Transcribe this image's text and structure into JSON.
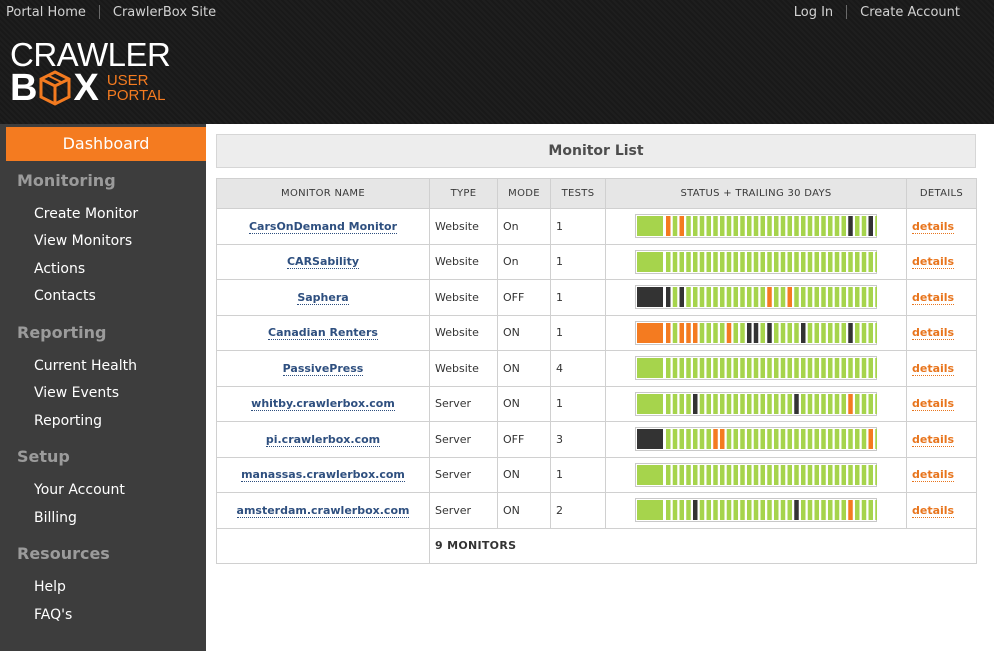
{
  "topnav": {
    "left": [
      "Portal Home",
      "CrawlerBox Site"
    ],
    "right": [
      "Log In",
      "Create Account"
    ]
  },
  "logo": {
    "line1": "CRAWLER",
    "b": "B",
    "x": "X",
    "sub1": "USER",
    "sub2": "PORTAL",
    "accent": "#f47b20"
  },
  "sidebar": {
    "dashboard": "Dashboard",
    "sections": [
      {
        "title": "Monitoring",
        "items": [
          "Create Monitor",
          "View Monitors",
          "Actions",
          "Contacts"
        ]
      },
      {
        "title": "Reporting",
        "items": [
          "Current Health",
          "View Events",
          "Reporting"
        ]
      },
      {
        "title": "Setup",
        "items": [
          "Your Account",
          "Billing"
        ]
      },
      {
        "title": "Resources",
        "items": [
          "Help",
          "FAQ's"
        ]
      }
    ]
  },
  "panel": {
    "title": "Monitor List"
  },
  "table": {
    "headers": [
      "MONITOR NAME",
      "TYPE",
      "MODE",
      "TESTS",
      "STATUS + TRAILING 30 DAYS",
      "DETAILS"
    ],
    "status_colors": {
      "g": "#a6d44c",
      "o": "#f47b20",
      "d": "#333333"
    },
    "rows": [
      {
        "name": "CarsOnDemand Monitor",
        "type": "Website",
        "mode": "On",
        "tests": "1",
        "current": "g",
        "days": "ogoggggggggggggggggggggggggdggdg",
        "details": "details"
      },
      {
        "name": "CARSability",
        "type": "Website",
        "mode": "On",
        "tests": "1",
        "current": "g",
        "days": "gggggggggggggggggggggggggggggggg",
        "details": "details"
      },
      {
        "name": "Saphera",
        "type": "Website",
        "mode": "OFF",
        "tests": "1",
        "current": "d",
        "days": "dgdggggggggggggoggoggggggggggggg",
        "details": "details"
      },
      {
        "name": "Canadian Renters",
        "type": "Website",
        "mode": "ON",
        "tests": "1",
        "current": "o",
        "days": "ogoooggggoggddgdggggdggggggdgggg",
        "details": "details"
      },
      {
        "name": "PassivePress",
        "type": "Website",
        "mode": "ON",
        "tests": "4",
        "current": "g",
        "days": "gggggggggggggggggggggggggggggggg",
        "details": "details"
      },
      {
        "name": "whitby.crawlerbox.com",
        "type": "Server",
        "mode": "ON",
        "tests": "1",
        "current": "g",
        "days": "ggggdggggggggggggggdgggggggogggg",
        "details": "details"
      },
      {
        "name": "pi.crawlerbox.com",
        "type": "Server",
        "mode": "OFF",
        "tests": "3",
        "current": "d",
        "days": "gggggggoogggggggggggggggggggggog",
        "details": "details"
      },
      {
        "name": "manassas.crawlerbox.com",
        "type": "Server",
        "mode": "ON",
        "tests": "1",
        "current": "g",
        "days": "gggggggggggggggggggggggggggggggg",
        "details": "details"
      },
      {
        "name": "amsterdam.crawlerbox.com",
        "type": "Server",
        "mode": "ON",
        "tests": "2",
        "current": "g",
        "days": "ggggdggggggggggggggdgggggggogggg",
        "details": "details"
      }
    ],
    "total": "9 MONITORS"
  }
}
